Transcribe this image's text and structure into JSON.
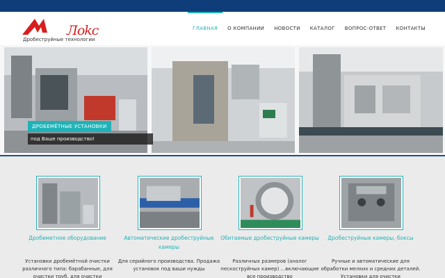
{
  "header": {
    "logo_text": "Лokc",
    "tagline": "Дробеструйные технологии"
  },
  "nav": {
    "items": [
      {
        "label": "ГЛАВНАЯ",
        "active": true
      },
      {
        "label": "О КОМПАНИИ"
      },
      {
        "label": "НОВОСТИ"
      },
      {
        "label": "КАТАЛОГ"
      },
      {
        "label": "ВОПРОС-ОТВЕТ"
      },
      {
        "label": "КОНТАКТЫ"
      }
    ]
  },
  "slider": {
    "caption_title": "ДРОБЕМЁТНЫЕ УСТАНОВКИ",
    "caption_subtitle": "под Ваше производство!"
  },
  "products": [
    {
      "title": "Дробеметное оборудование",
      "description": "Установки дробемётной очистки различного типа: барабанные, для очистки труб, для очистки"
    },
    {
      "title": "Автоматические дробеструйные камеры",
      "description": "Для серийного производства. Продажа установок под ваши нужды"
    },
    {
      "title": "Обитаемые дробеструйные камеры",
      "description": "Различных размеров (аналог пескоструйных камер) ...включающие все производство"
    },
    {
      "title": "Дробеструйные камеры, боксы",
      "description": "Ручные и автоматические для обработки мелких и средних деталей. Установки для очистки"
    }
  ],
  "colors": {
    "accent": "#1fb3b8",
    "topbar": "#0f3d7a",
    "logo": "#d81e1e"
  }
}
